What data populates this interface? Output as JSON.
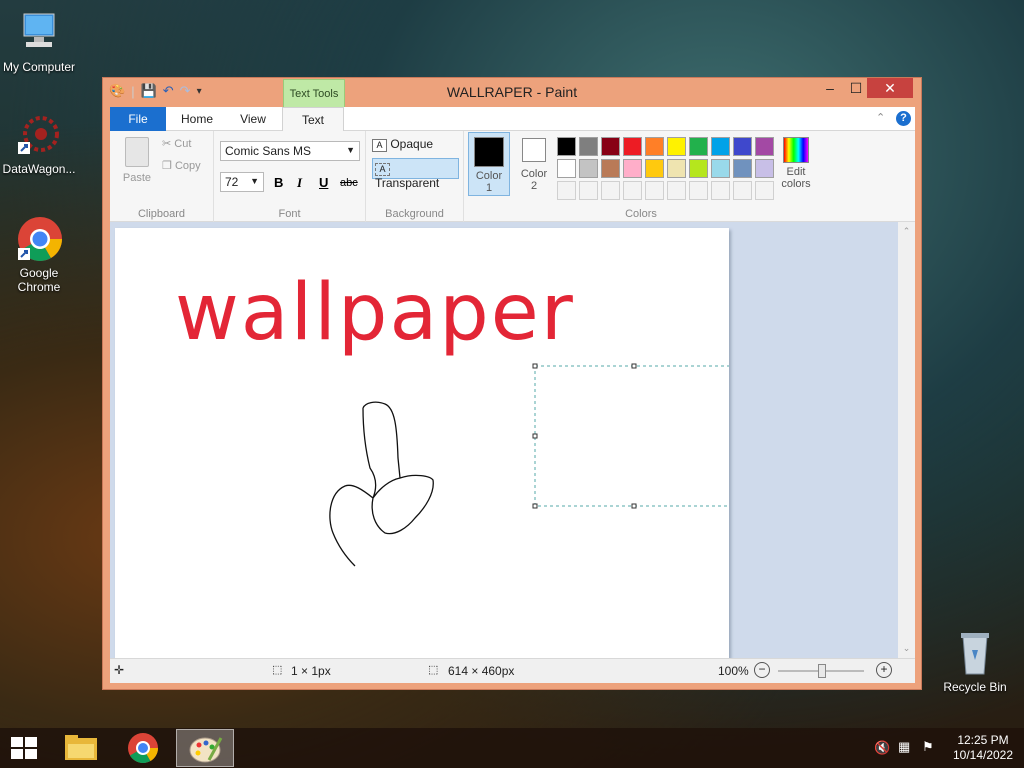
{
  "desktop": {
    "icons": [
      {
        "label": "My Computer"
      },
      {
        "label": "DataWagon..."
      },
      {
        "label": "Google Chrome"
      },
      {
        "label": "Recycle Bin"
      }
    ]
  },
  "window": {
    "title": "WALLRAPER - Paint",
    "contextual_tab": "Text Tools"
  },
  "tabs": {
    "file": "File",
    "home": "Home",
    "view": "View",
    "text": "Text"
  },
  "clipboard": {
    "paste": "Paste",
    "cut": "Cut",
    "copy": "Copy",
    "label": "Clipboard"
  },
  "font": {
    "family": "Comic Sans MS",
    "size": "72",
    "bold": "B",
    "italic": "I",
    "underline": "U",
    "strike": "abc",
    "label": "Font"
  },
  "background": {
    "opaque": "Opaque",
    "transparent": "Transparent",
    "label": "Background"
  },
  "colors": {
    "color1_label": "Color\n1",
    "color1_a": "Color",
    "color1_b": "1",
    "color2_a": "Color",
    "color2_b": "2",
    "edit_a": "Edit",
    "edit_b": "colors",
    "label": "Colors",
    "color1": "#000000",
    "color2": "#ffffff",
    "palette_row1": [
      "#000000",
      "#7f7f7f",
      "#880015",
      "#ed1c24",
      "#ff7f27",
      "#fff200",
      "#22b14c",
      "#00a2e8",
      "#3f48cc",
      "#a349a4"
    ],
    "palette_row2": [
      "#ffffff",
      "#c3c3c3",
      "#b97a57",
      "#ffaec9",
      "#ffc90e",
      "#efe4b0",
      "#b5e61d",
      "#99d9ea",
      "#7092be",
      "#c8bfe7"
    ]
  },
  "canvas": {
    "text": "wallpaper",
    "text_color": "#e32636"
  },
  "status": {
    "cursor": "1 × 1px",
    "size": "614 × 460px",
    "zoom": "100%"
  },
  "taskbar": {
    "time": "12:25 PM",
    "date": "10/14/2022"
  }
}
